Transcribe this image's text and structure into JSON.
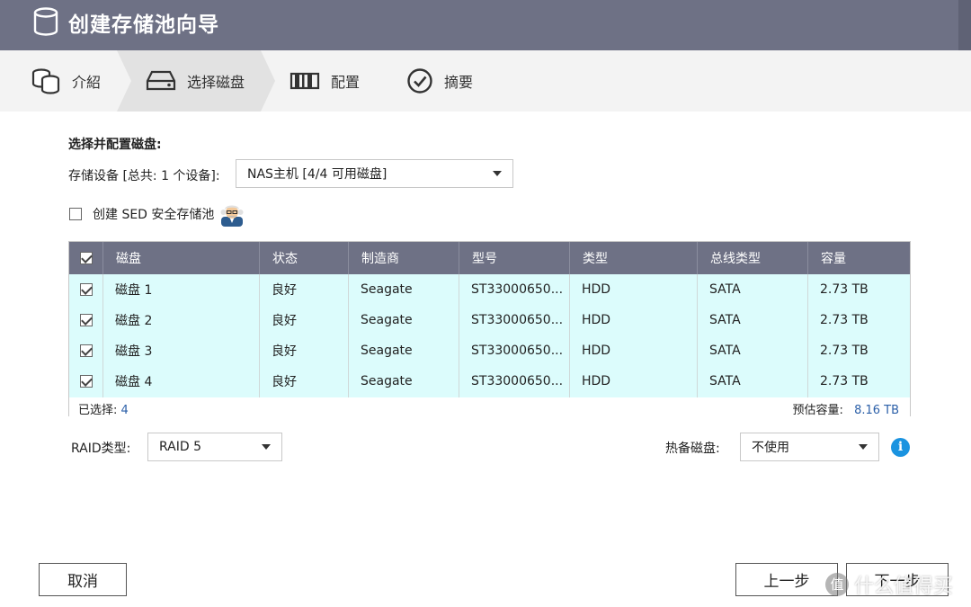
{
  "window": {
    "title": "创建存储池向导"
  },
  "steps": [
    {
      "label": "介紹"
    },
    {
      "label": "选择磁盘"
    },
    {
      "label": "配置"
    },
    {
      "label": "摘要"
    }
  ],
  "content": {
    "section_title": "选择并配置磁盘:",
    "device_label": "存储设备 [总共: 1 个设备]:",
    "device_value": "NAS主机 [4/4 可用磁盘]",
    "sed_label": "创建 SED 安全存储池"
  },
  "table": {
    "headers": [
      "磁盘",
      "状态",
      "制造商",
      "型号",
      "类型",
      "总线类型",
      "容量"
    ],
    "rows": [
      {
        "disk": "磁盘 1",
        "status": "良好",
        "vendor": "Seagate",
        "model": "ST33000650...",
        "type": "HDD",
        "bus": "SATA",
        "capacity": "2.73 TB"
      },
      {
        "disk": "磁盘 2",
        "status": "良好",
        "vendor": "Seagate",
        "model": "ST33000650...",
        "type": "HDD",
        "bus": "SATA",
        "capacity": "2.73 TB"
      },
      {
        "disk": "磁盘 3",
        "status": "良好",
        "vendor": "Seagate",
        "model": "ST33000650...",
        "type": "HDD",
        "bus": "SATA",
        "capacity": "2.73 TB"
      },
      {
        "disk": "磁盘 4",
        "status": "良好",
        "vendor": "Seagate",
        "model": "ST33000650...",
        "type": "HDD",
        "bus": "SATA",
        "capacity": "2.73 TB"
      }
    ],
    "selected_label": "已选择:",
    "selected_count": "4",
    "estimated_label": "预估容量:",
    "estimated_value": "8.16 TB"
  },
  "raid": {
    "label": "RAID类型:",
    "value": "RAID 5",
    "spare_label": "热备磁盘:",
    "spare_value": "不使用"
  },
  "buttons": {
    "cancel": "取消",
    "prev": "上一步",
    "next": "下一步"
  },
  "watermark": {
    "badge": "值",
    "text": "什么值得买"
  },
  "colors": {
    "header_bg": "#6e7185",
    "row_bg": "#dcfcfc",
    "link_blue": "#2b5fa8",
    "info_blue": "#1a93e0"
  }
}
